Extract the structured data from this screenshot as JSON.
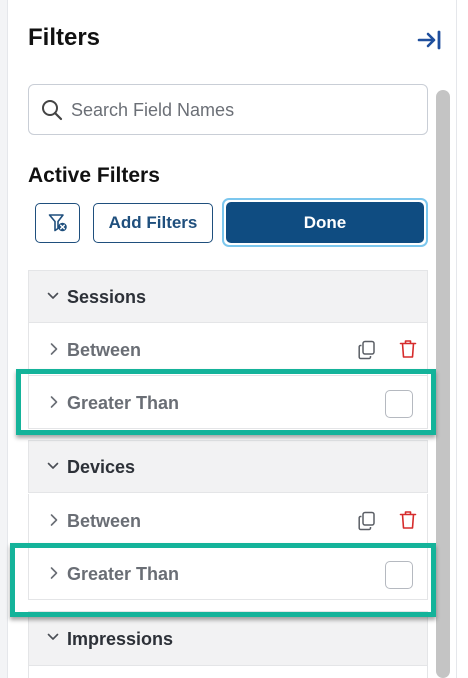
{
  "panel": {
    "title": "Filters"
  },
  "search": {
    "placeholder": "Search Field Names",
    "value": ""
  },
  "active_filters": {
    "title": "Active Filters",
    "add_filters_label": "Add Filters",
    "done_label": "Done"
  },
  "groups": [
    {
      "label": "Sessions",
      "expanded": true,
      "rows": [
        {
          "label": "Between",
          "actions": [
            "copy-icon",
            "trash-icon"
          ]
        },
        {
          "label": "Greater Than",
          "checkbox_checked": false,
          "highlighted": true
        }
      ]
    },
    {
      "label": "Devices",
      "expanded": true,
      "rows": [
        {
          "label": "Between",
          "actions": [
            "copy-icon",
            "trash-icon"
          ]
        },
        {
          "label": "Greater Than",
          "checkbox_checked": false,
          "highlighted": true
        }
      ]
    },
    {
      "label": "Impressions",
      "expanded": true,
      "rows": []
    }
  ],
  "colors": {
    "accent": "#0f4c81",
    "highlight": "#14b39a",
    "delete": "#d62b2b",
    "focus_ring": "#7cc7ee"
  }
}
